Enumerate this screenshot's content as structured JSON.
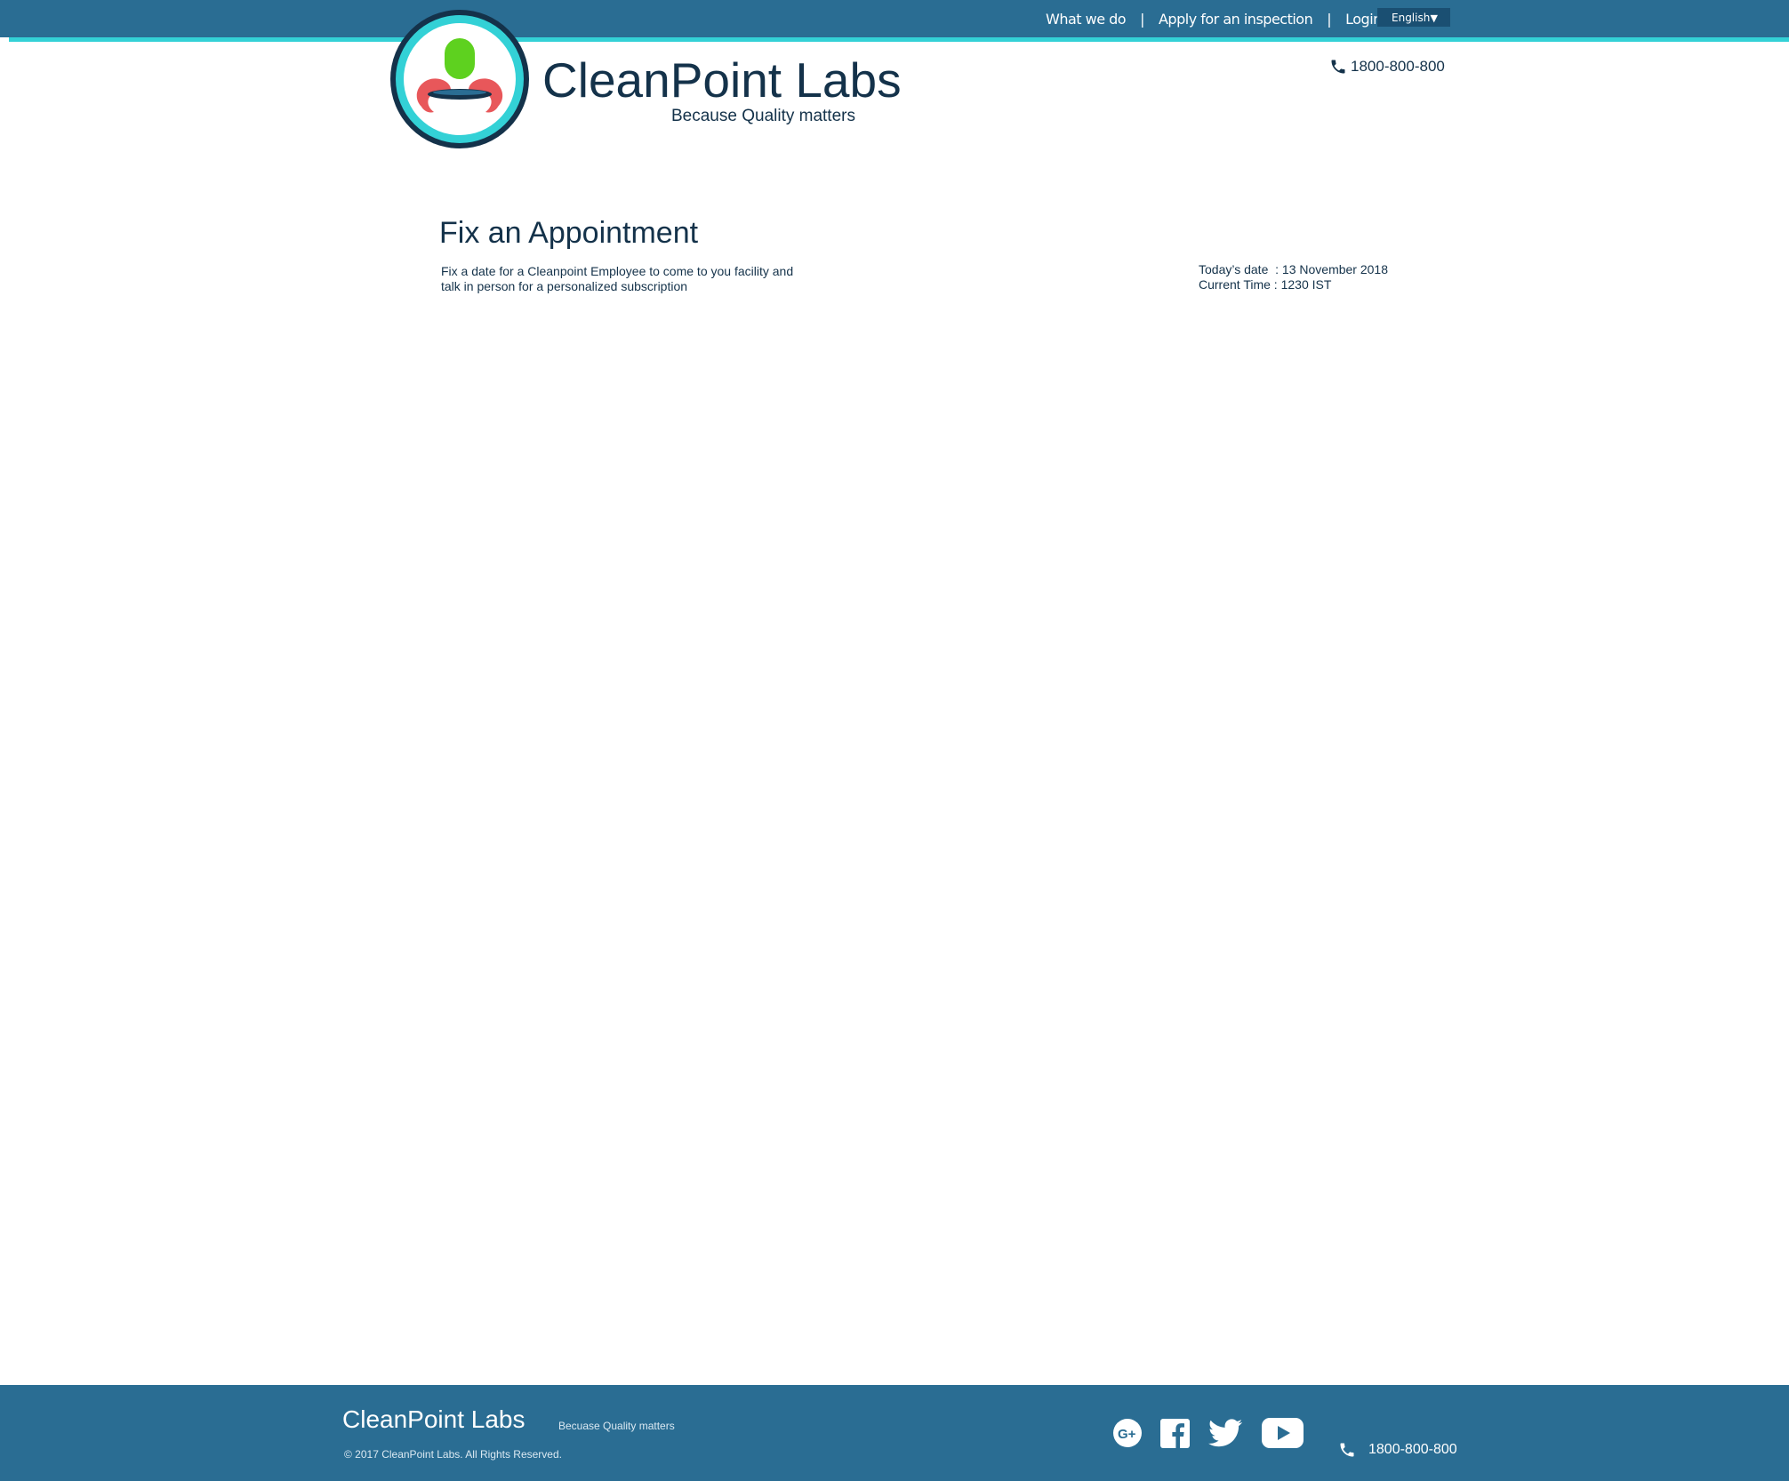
{
  "nav": {
    "items": [
      "What we do",
      "Apply for an inspection",
      "Login"
    ],
    "separator": "|",
    "language": "English",
    "language_caret": "▼"
  },
  "brand": {
    "name": "CleanPoint Labs",
    "tagline": "Because Quality matters",
    "logo_icon": "clean-lab-logo"
  },
  "contact": {
    "phone": "1800-800-800",
    "phone_icon": "phone-icon"
  },
  "main": {
    "title": "Fix an Appointment",
    "description_line1": "Fix a date for a Cleanpoint Employee to come to you facility and",
    "description_line2": "talk in person for a personalized subscription",
    "date_label": "Today’s date  :",
    "date_value": "13 November 2018",
    "time_label": "Current Time :",
    "time_value": "1230 IST"
  },
  "footer": {
    "brand": "CleanPoint Labs",
    "tagline": "Becuase Quality matters",
    "copyright": "© 2017 CleanPoint Labs. All Rights Reserved.",
    "phone": "1800-800-800",
    "social_icons": [
      "google-plus-icon",
      "facebook-icon",
      "twitter-icon",
      "youtube-icon"
    ]
  },
  "colors": {
    "header_bg": "#2a6d93",
    "accent": "#33d1d6",
    "dark_text": "#14324a",
    "logo_green": "#5ed11f",
    "logo_red": "#e8575a"
  }
}
